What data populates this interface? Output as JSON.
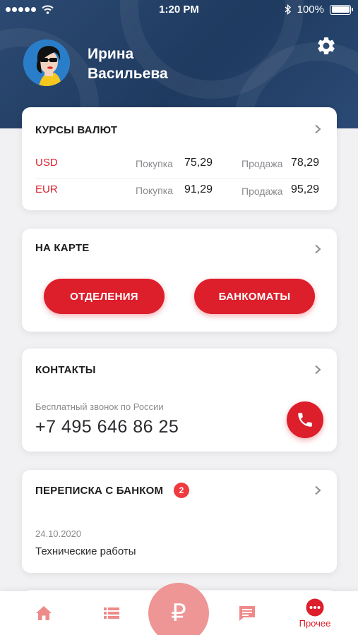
{
  "status_bar": {
    "time": "1:20 PM",
    "battery": "100%",
    "signal_icon": "signal-dots-icon",
    "wifi_icon": "wifi-icon",
    "bluetooth_icon": "bluetooth-icon"
  },
  "profile": {
    "first_name": "Ирина",
    "last_name": "Васильева",
    "settings_icon": "gear-icon"
  },
  "rates": {
    "title": "КУРСЫ ВАЛЮТ",
    "rows": [
      {
        "currency": "USD",
        "buy_label": "Покупка",
        "buy": "75,29",
        "sell_label": "Продажа",
        "sell": "78,29"
      },
      {
        "currency": "EUR",
        "buy_label": "Покупка",
        "buy": "91,29",
        "sell_label": "Продажа",
        "sell": "95,29"
      }
    ]
  },
  "map": {
    "title": "НА КАРТЕ",
    "branches_label": "ОТДЕЛЕНИЯ",
    "atms_label": "БАНКОМАТЫ"
  },
  "contacts": {
    "title": "КОНТАКТЫ",
    "caption": "Бесплатный звонок по России",
    "phone": "+7 495 646 86 25"
  },
  "messages": {
    "title": "ПЕРЕПИСКА С БАНКОМ",
    "badge": "2",
    "date": "24.10.2020",
    "text": "Технические работы"
  },
  "tabbar": {
    "center_symbol": "₽",
    "more_label": "Прочее"
  },
  "colors": {
    "accent": "#dd1e2b",
    "header": "#1f3a5f"
  }
}
